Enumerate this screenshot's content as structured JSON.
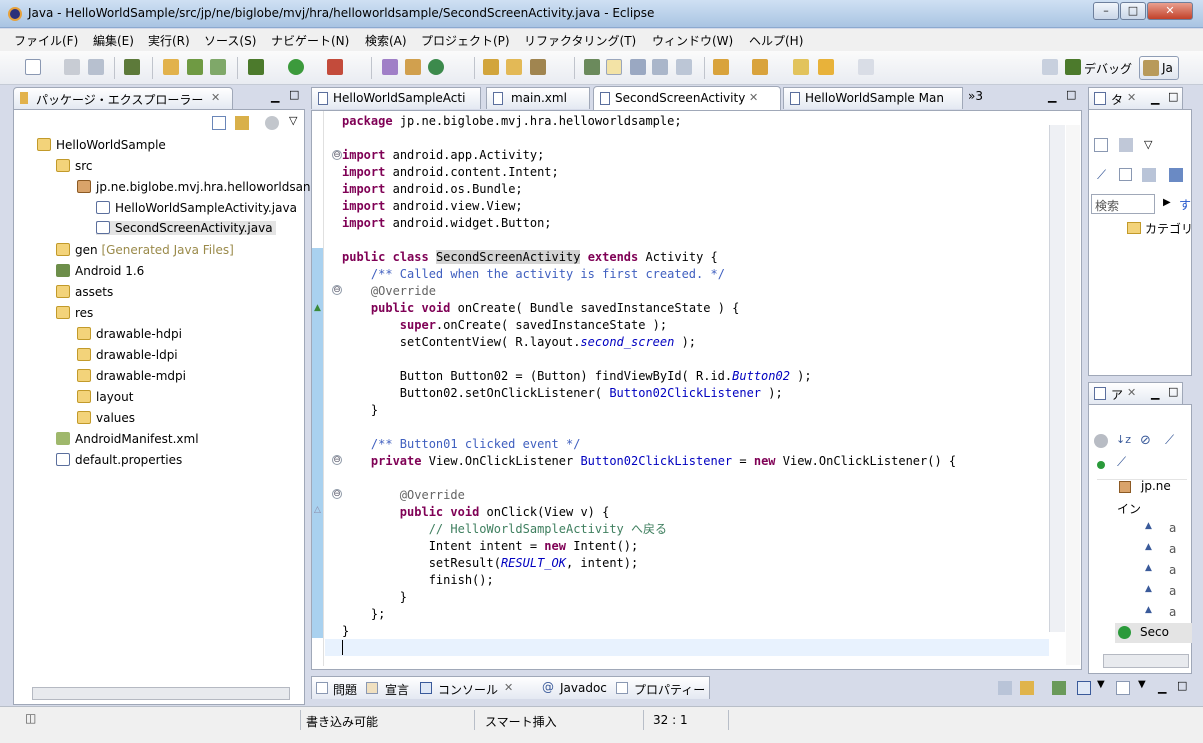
{
  "window": {
    "title": "Java - HelloWorldSample/src/jp/ne/biglobe/mvj/hra/helloworldsample/SecondScreenActivity.java - Eclipse",
    "minimize": "–",
    "maximize": "□",
    "close": "✕"
  },
  "menu": [
    "ファイル(F)",
    "編集(E)",
    "実行(R)",
    "ソース(S)",
    "ナビゲート(N)",
    "検索(A)",
    "プロジェクト(P)",
    "リファクタリング(T)",
    "ウィンドウ(W)",
    "ヘルプ(H)"
  ],
  "perspectives": {
    "debug": "デバッグ",
    "java": "Ja"
  },
  "explorer": {
    "title": "パッケージ・エクスプローラー",
    "items": [
      {
        "label": "HelloWorldSample",
        "suffix": ""
      },
      {
        "label": "src",
        "suffix": ""
      },
      {
        "label": "jp.ne.biglobe.mvj.hra.helloworldsan",
        "suffix": ""
      },
      {
        "label": "HelloWorldSampleActivity.java",
        "suffix": ""
      },
      {
        "label": "SecondScreenActivity.java",
        "suffix": ""
      },
      {
        "label": "gen",
        "suffix": "[Generated Java Files]"
      },
      {
        "label": "Android 1.6",
        "suffix": ""
      },
      {
        "label": "assets",
        "suffix": ""
      },
      {
        "label": "res",
        "suffix": ""
      },
      {
        "label": "drawable-hdpi",
        "suffix": ""
      },
      {
        "label": "drawable-ldpi",
        "suffix": ""
      },
      {
        "label": "drawable-mdpi",
        "suffix": ""
      },
      {
        "label": "layout",
        "suffix": ""
      },
      {
        "label": "values",
        "suffix": ""
      },
      {
        "label": "AndroidManifest.xml",
        "suffix": ""
      },
      {
        "label": "default.properties",
        "suffix": ""
      }
    ]
  },
  "editor_tabs": [
    {
      "label": "HelloWorldSampleActi",
      "active": false
    },
    {
      "label": "main.xml",
      "active": false
    },
    {
      "label": "SecondScreenActivity",
      "active": true
    },
    {
      "label": "HelloWorldSample Man",
      "active": false
    }
  ],
  "editor_overflow": "»3",
  "code": {
    "l1": "jp.ne.biglobe.mvj.hra.helloworldsample;",
    "imports": [
      "android.app.Activity;",
      "android.content.Intent;",
      "android.os.Bundle;",
      "android.view.View;",
      "android.widget.Button;"
    ],
    "class_name": "SecondScreenActivity",
    "super_class": "Activity {",
    "doc1": "/** Called when the activity is first created. */",
    "override": "@Override",
    "oncreate_sig": "onCreate( Bundle savedInstanceState ) {",
    "super_call": ".onCreate( savedInstanceState );",
    "setcontent_a": "setContentView( R.layout.",
    "setcontent_field": "second_screen",
    "setcontent_b": " );",
    "button_decl_a": "Button Button02 = (Button) findViewById( R.id.",
    "button_decl_field": "Button02",
    "button_decl_b": " );",
    "set_listener_a": "Button02.setOnClickListener( ",
    "set_listener_field": "Button02ClickListener",
    "set_listener_b": " );",
    "close_brace": "}",
    "doc2": "/** Button01 clicked event */",
    "listener_type": "View.OnClickListener ",
    "listener_field": "Button02ClickListener",
    "listener_assign": " = ",
    "listener_ctor": "View.OnClickListener() {",
    "onclick_sig": "onClick(View v) {",
    "line_comment": "// HelloWorldSampleActivity へ戻る",
    "intent_a": "Intent intent = ",
    "intent_b": "Intent();",
    "setresult_a": "setResult(",
    "setresult_field": "RESULT_OK",
    "setresult_b": ", intent);",
    "finish": "finish();",
    "inner_close": "}",
    "anon_close": "};",
    "class_close": "}"
  },
  "outline_top": {
    "tab": "タ",
    "search_placeholder": "検索",
    "link": "す",
    "category": "カテゴリ"
  },
  "outline_bottom": {
    "tab": "ア",
    "items": [
      "jp.ne",
      "イン",
      "a",
      "a",
      "a",
      "a",
      "a",
      "Seco"
    ]
  },
  "bottom_tabs": [
    "問題",
    "宣言",
    "コンソール",
    "Javadoc",
    "プロパティー"
  ],
  "status": {
    "writable": "書き込み可能",
    "insert_mode": "スマート挿入",
    "position": "32 : 1"
  }
}
